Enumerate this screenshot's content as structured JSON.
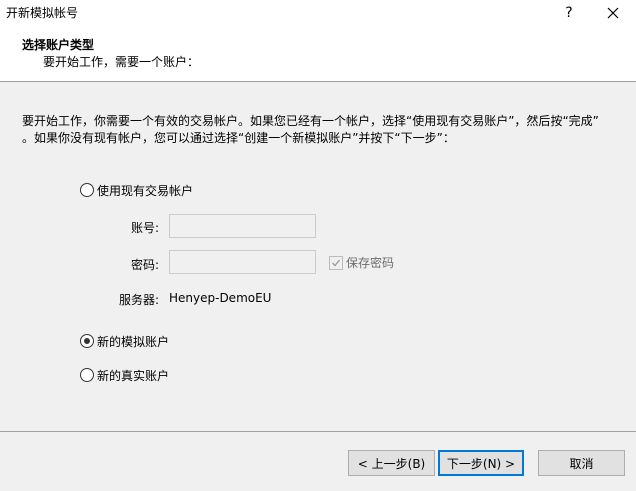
{
  "window": {
    "title": "开新模拟帐号",
    "help_glyph": "?",
    "close_icon": "close-icon"
  },
  "header": {
    "title": "选择账户类型",
    "subtitle": "要开始工作，需要一个账户："
  },
  "description": {
    "line1": "要开始工作，你需要一个有效的交易帐户。如果您已经有一个帐户，选择“使用现有交易账户”，然后按“完成”",
    "line2": "。如果你没有现有帐户，您可以通过选择“创建一个新模拟账户”并按下“下一步”："
  },
  "options": {
    "existing": {
      "label": "使用现有交易帐户",
      "checked": false
    },
    "demo": {
      "label": "新的模拟账户",
      "checked": true
    },
    "real": {
      "label": "新的真实账户",
      "checked": false
    }
  },
  "fields": {
    "account_label": "账号:",
    "account_value": "",
    "password_label": "密码:",
    "password_value": "",
    "save_password_label": "保存密码",
    "save_password_checked": true,
    "server_label": "服务器:",
    "server_value": "Henyep-DemoEU"
  },
  "buttons": {
    "back": "< 上一步(B)",
    "next": "下一步(N) >",
    "cancel": "取消"
  },
  "colors": {
    "body_background": "#f0f0f0",
    "primary_button_border": "#0078d7",
    "disabled_text": "#6d6d6d"
  }
}
